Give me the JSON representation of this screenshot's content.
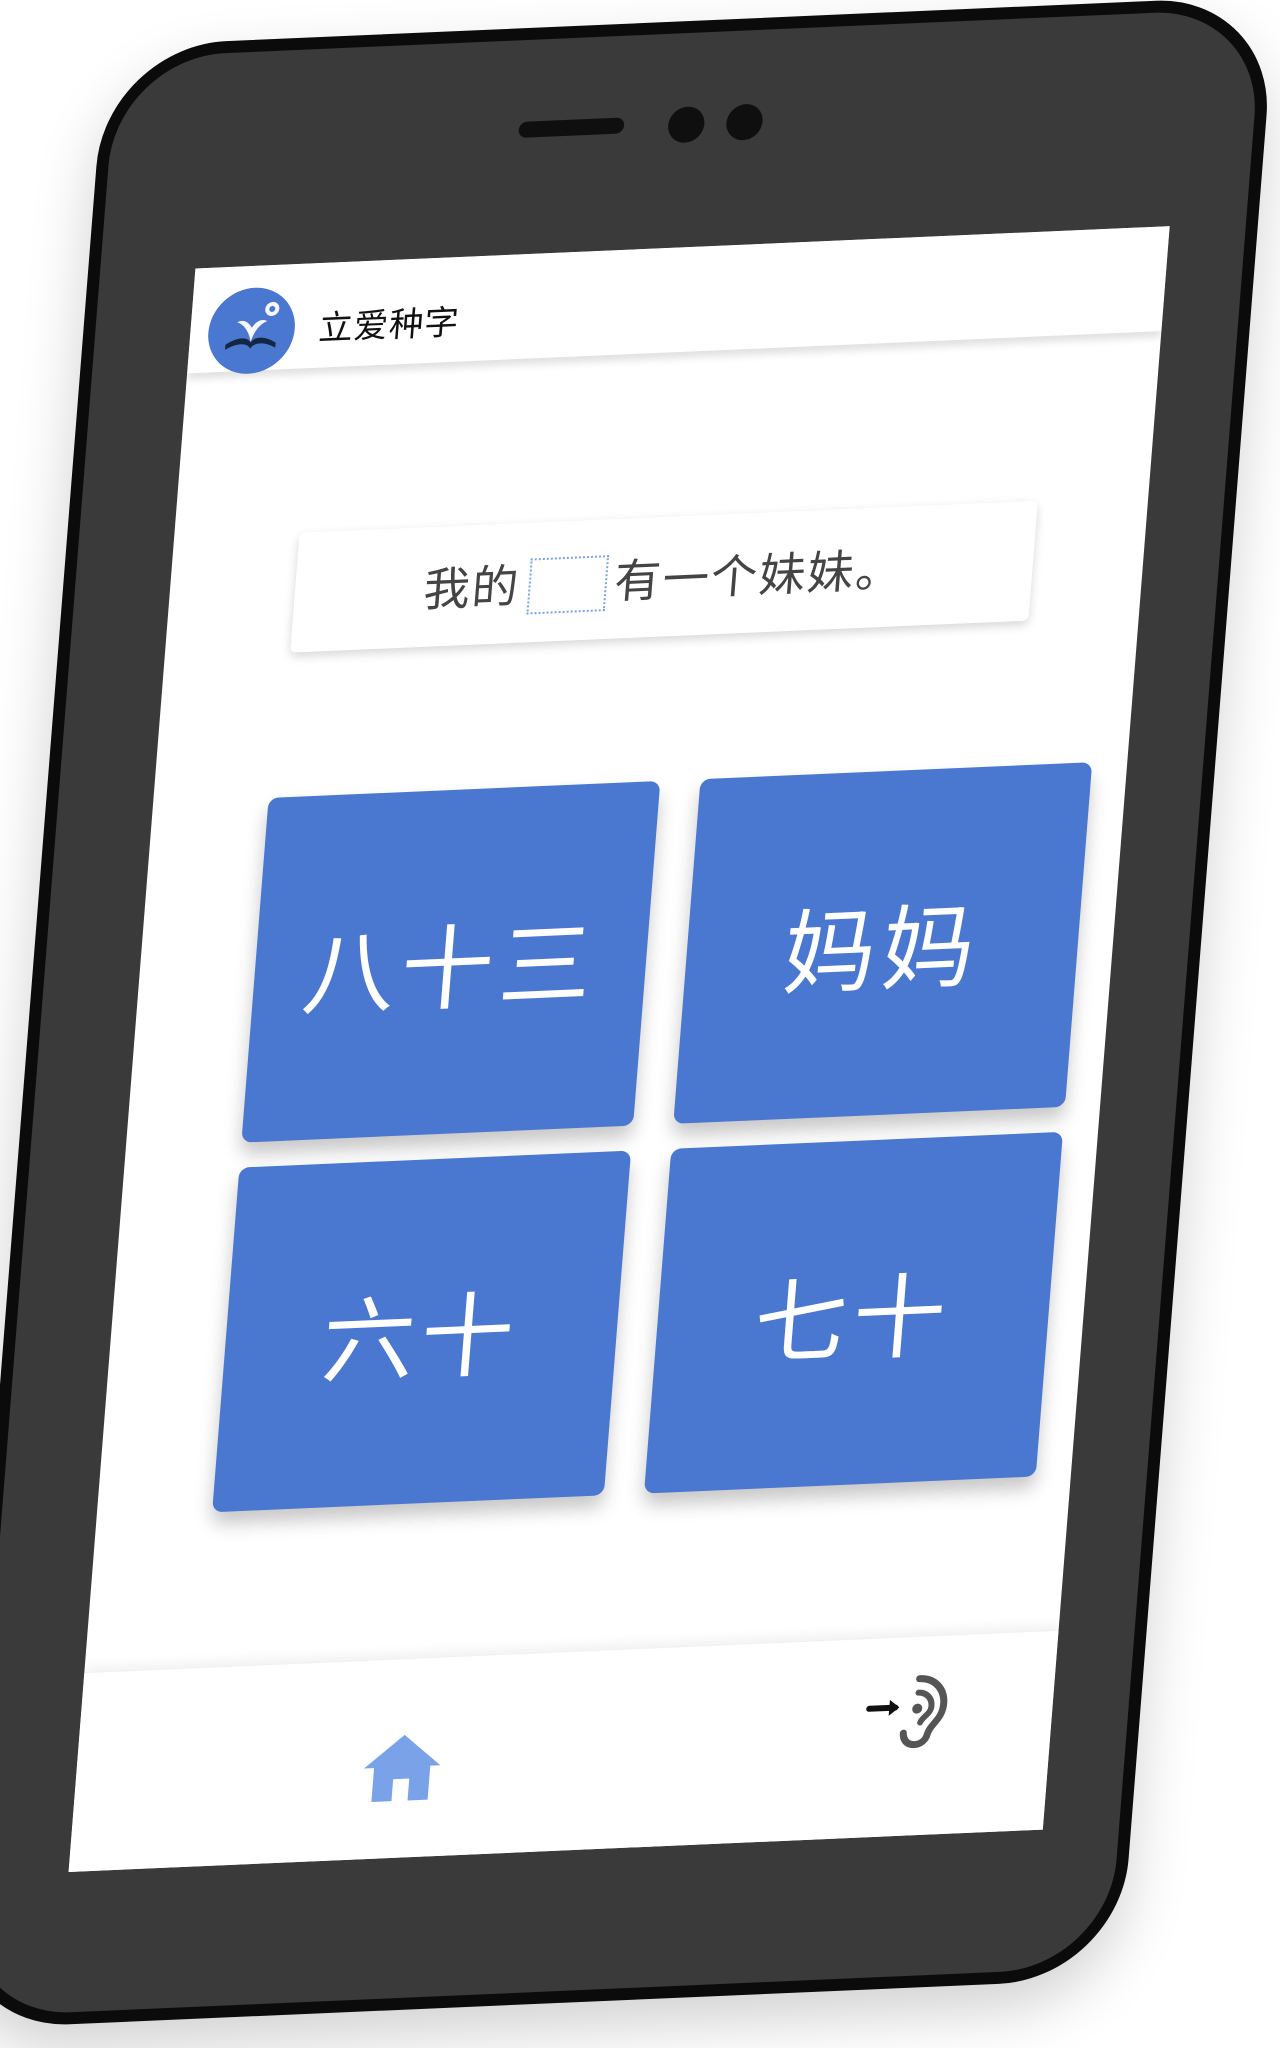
{
  "app": {
    "title": "立爱种字"
  },
  "question": {
    "before": "我的",
    "after": "有一个妹妹。"
  },
  "answers": [
    {
      "label": "八十三"
    },
    {
      "label": "妈妈"
    },
    {
      "label": "六十"
    },
    {
      "label": "七十"
    }
  ],
  "nav": {
    "home_icon": "home-icon",
    "listen_icon": "listen-icon"
  },
  "colors": {
    "primary": "#4a78d0",
    "home_icon": "#7aa2e8",
    "icon_gray": "#555555"
  }
}
